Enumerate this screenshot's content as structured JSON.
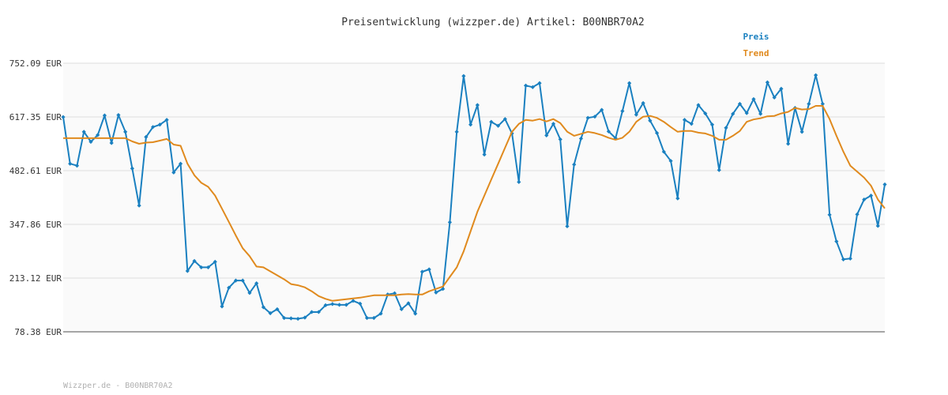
{
  "chart_data": {
    "type": "line",
    "title": "Preisentwicklung (wizzper.de) Artikel: B00NBR70A2",
    "footer": "Wizzper.de - B00NBR70A2",
    "xlabel": "",
    "ylabel": "",
    "ylim": [
      78.38,
      752.09
    ],
    "yticks": [
      "752.09 EUR",
      "617.35 EUR",
      "482.61 EUR",
      "347.86 EUR",
      "213.12 EUR",
      "78.38 EUR"
    ],
    "ytick_values": [
      752.09,
      617.35,
      482.61,
      347.86,
      213.12,
      78.38
    ],
    "grid": true,
    "legend_position": "top-right",
    "series": [
      {
        "name": "Preis",
        "color": "#1a80c0",
        "values": [
          617,
          500,
          495,
          580,
          555,
          572,
          621,
          552,
          622,
          580,
          488,
          395,
          567,
          592,
          598,
          610,
          478,
          500,
          231,
          256,
          240,
          240,
          254,
          142,
          189,
          207,
          207,
          176,
          200,
          140,
          125,
          135,
          113,
          112,
          111,
          114,
          128,
          128,
          145,
          148,
          146,
          146,
          156,
          149,
          113,
          113,
          124,
          172,
          175,
          135,
          150,
          124,
          229,
          235,
          177,
          186,
          353,
          580,
          720,
          598,
          647,
          523,
          605,
          595,
          612,
          576,
          454,
          696,
          692,
          702,
          571,
          600,
          561,
          343,
          498,
          563,
          615,
          618,
          635,
          581,
          564,
          632,
          702,
          623,
          652,
          608,
          577,
          530,
          507,
          413,
          610,
          600,
          647,
          626,
          598,
          484,
          590,
          625,
          650,
          627,
          662,
          625,
          704,
          666,
          688,
          550,
          640,
          580,
          650,
          722,
          650,
          372,
          305,
          260,
          262,
          373,
          410,
          420,
          344,
          448
        ]
      },
      {
        "name": "Trend",
        "color": "#e08a1e",
        "values": [
          564,
          564,
          564,
          564,
          564,
          564,
          564,
          564,
          564,
          564,
          556,
          550,
          553,
          554,
          558,
          562,
          548,
          545,
          500,
          471,
          452,
          442,
          420,
          387,
          354,
          320,
          288,
          268,
          242,
          240,
          230,
          220,
          210,
          198,
          195,
          190,
          180,
          168,
          161,
          156,
          158,
          160,
          162,
          164,
          167,
          170,
          170,
          170,
          170,
          172,
          173,
          172,
          172,
          180,
          186,
          192,
          216,
          240,
          280,
          330,
          380,
          420,
          460,
          500,
          540,
          580,
          600,
          610,
          608,
          612,
          606,
          612,
          602,
          580,
          570,
          575,
          580,
          577,
          572,
          565,
          560,
          565,
          580,
          605,
          618,
          620,
          615,
          605,
          592,
          580,
          582,
          582,
          578,
          576,
          570,
          560,
          560,
          570,
          582,
          605,
          611,
          614,
          619,
          620,
          626,
          630,
          640,
          636,
          637,
          645,
          645,
          612,
          570,
          530,
          495,
          480,
          465,
          445,
          410,
          388
        ]
      }
    ]
  }
}
